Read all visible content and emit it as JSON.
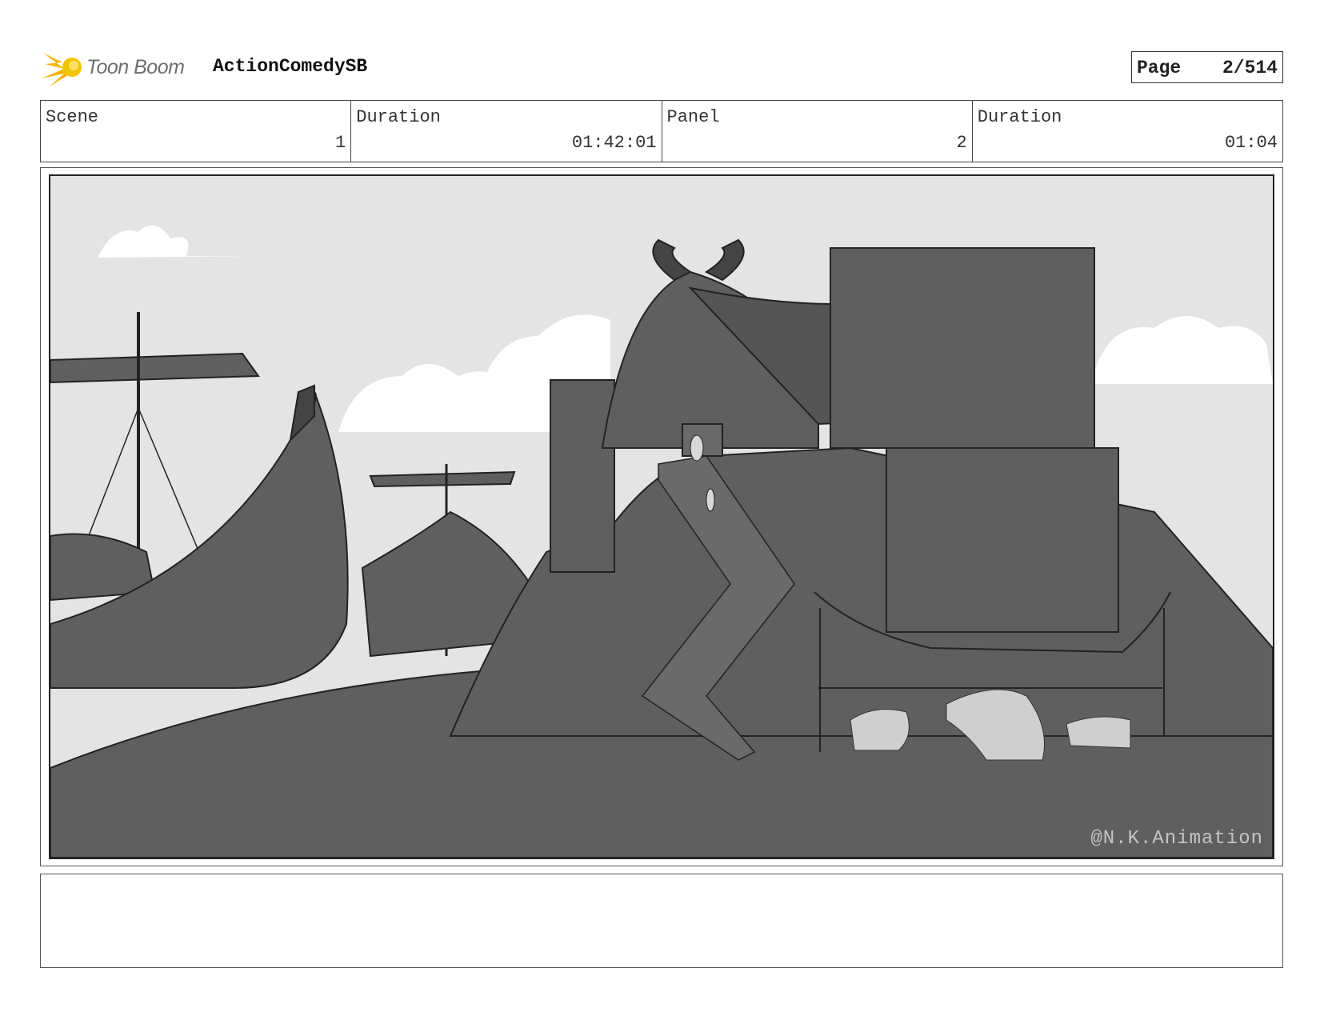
{
  "header": {
    "logo_text": "Toon Boom",
    "project_title": "ActionComedySB",
    "page_label": "Page",
    "page_value": "2/514"
  },
  "info": {
    "scene_label": "Scene",
    "scene_value": "1",
    "scene_duration_label": "Duration",
    "scene_duration_value": "01:42:01",
    "panel_label": "Panel",
    "panel_value": "2",
    "panel_duration_label": "Duration",
    "panel_duration_value": "01:04"
  },
  "panel": {
    "watermark": "@N.K.Animation"
  },
  "notes": {
    "text": ""
  }
}
